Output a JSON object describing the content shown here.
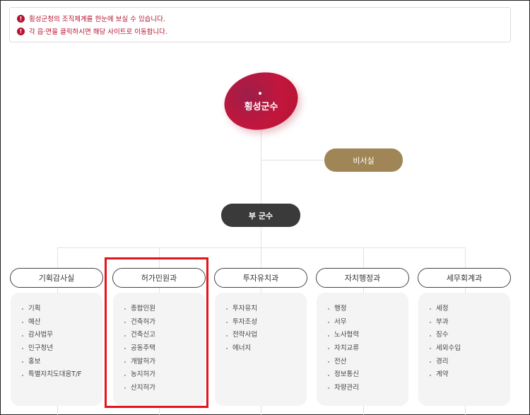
{
  "notices": [
    "횡성군청의 조직체계를 한눈에 보실 수 있습니다.",
    "각 읍·면을 클릭하시면 해당 사이트로 이동합니다."
  ],
  "head": {
    "label": "횡성군수"
  },
  "secretary": {
    "label": "비서실"
  },
  "deputy": {
    "label": "부 군수"
  },
  "departments": [
    {
      "label": "기획감사실",
      "items": [
        "기획",
        "예산",
        "감사법무",
        "인구청년",
        "홍보",
        "특별자치도대응T/F"
      ]
    },
    {
      "label": "허가민원과",
      "items": [
        "종합민원",
        "건축허가",
        "건축신고",
        "공동주택",
        "개발허가",
        "농지허가",
        "산지허가"
      ]
    },
    {
      "label": "투자유치과",
      "items": [
        "투자유치",
        "투자조성",
        "전략사업",
        "에너지"
      ]
    },
    {
      "label": "자치행정과",
      "items": [
        "행정",
        "서무",
        "노사협력",
        "자치교류",
        "전산",
        "정보통신",
        "차량관리"
      ]
    },
    {
      "label": "세무회계과",
      "items": [
        "세정",
        "부과",
        "징수",
        "세외수입",
        "경리",
        "계약"
      ]
    }
  ],
  "colors": {
    "accent": "#b5122f",
    "secretary": "#a08656",
    "deputy": "#3a3a3a",
    "highlight": "#e3141b"
  }
}
